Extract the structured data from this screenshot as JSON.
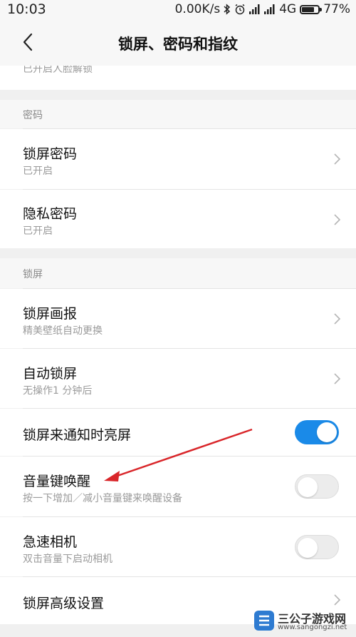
{
  "status_bar": {
    "time": "10:03",
    "speed": "0.00K/s",
    "network": "4G",
    "battery_percent": "77%",
    "battery_level": 0.77,
    "icons": [
      "bluetooth-icon",
      "alarm-icon",
      "signal-icon",
      "signal-icon",
      "battery-icon"
    ]
  },
  "header": {
    "title": "锁屏、密码和指纹",
    "back_icon": "chevron-left-icon"
  },
  "partial_row": {
    "subtitle": "已开启人脸解锁"
  },
  "sections": {
    "password": {
      "header": "密码",
      "items": [
        {
          "title": "锁屏密码",
          "subtitle": "已开启"
        },
        {
          "title": "隐私密码",
          "subtitle": "已开启"
        }
      ]
    },
    "lockscreen": {
      "header": "锁屏",
      "items": [
        {
          "title": "锁屏画报",
          "subtitle": "精美壁纸自动更换"
        },
        {
          "title": "自动锁屏",
          "subtitle": "无操作1 分钟后"
        },
        {
          "title": "锁屏来通知时亮屏",
          "toggle": true
        },
        {
          "title": "音量键唤醒",
          "subtitle": "按一下增加／减小音量键来唤醒设备",
          "toggle": false
        },
        {
          "title": "急速相机",
          "subtitle": "双击音量下启动相机",
          "toggle": false
        },
        {
          "title": "锁屏高级设置"
        }
      ]
    }
  },
  "watermark": {
    "name": "三公子游戏网",
    "url": "www.sangongzi.net"
  },
  "colors": {
    "accent": "#1a8ae8",
    "annotation_arrow": "#d9262a",
    "page_background": "#f0f0f0"
  }
}
